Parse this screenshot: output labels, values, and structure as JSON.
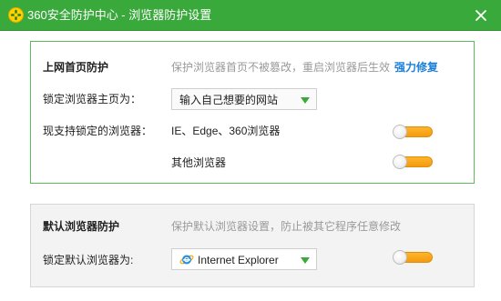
{
  "window": {
    "title": "360安全防护中心 - 浏览器防护设置"
  },
  "homepage_protection": {
    "heading": "上网首页防护",
    "description": "保护浏览器首页不被篡改，重启浏览器后生效",
    "repair_link": "强力修复",
    "lock_label": "锁定浏览器主页为：",
    "lock_value": "输入自己想要的网站",
    "supported_label": "现支持锁定的浏览器：",
    "browsers": [
      {
        "label": "IE、Edge、360浏览器",
        "toggle_state": "on"
      },
      {
        "label": "其他浏览器",
        "toggle_state": "on"
      }
    ]
  },
  "default_browser_protection": {
    "heading": "默认浏览器防护",
    "description": "保护默认浏览器设置，防止被其它程序任意修改",
    "lock_label": "锁定默认浏览器为:",
    "lock_value": "Internet Explorer",
    "toggle_state": "on"
  },
  "colors": {
    "titlebar": "#3aa93c",
    "panel_border": "#5cb95c",
    "toggle_on": "#f7a21b",
    "link": "#1c7fd8",
    "arrow": "#3aa93c"
  },
  "icons": {
    "logo": "360-logo-icon",
    "close": "close-icon",
    "dropdown": "triangle-down-icon",
    "ie": "internet-explorer-icon"
  }
}
